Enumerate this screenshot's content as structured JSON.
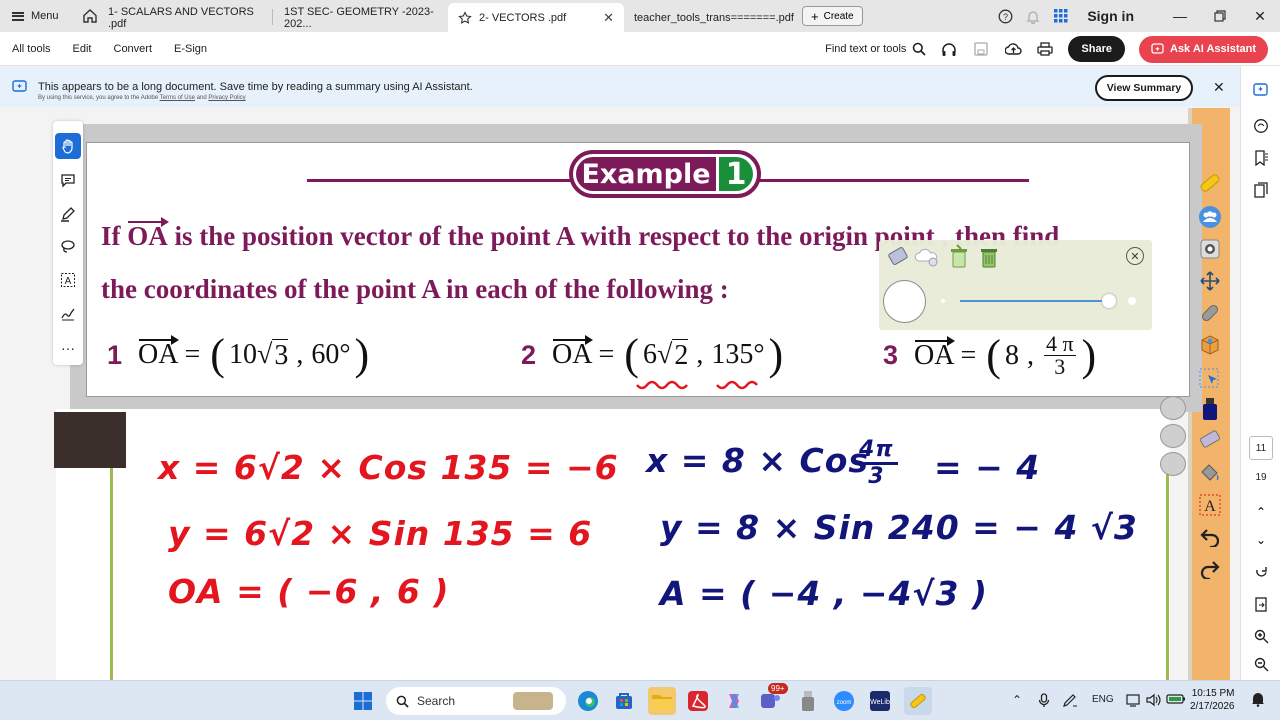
{
  "tabs": {
    "menu_label": "Menu",
    "items": [
      {
        "label": "1- SCALARS AND VECTORS .pdf"
      },
      {
        "label": "1ST SEC- GEOMETRY -2023-202..."
      },
      {
        "label": "2- VECTORS .pdf"
      },
      {
        "label": "teacher_tools_trans=======.pdf"
      }
    ],
    "create_label": "Create",
    "signin_label": "Sign in"
  },
  "toolbar": {
    "items": [
      "All tools",
      "Edit",
      "Convert",
      "E-Sign"
    ],
    "find_label": "Find text or tools",
    "share_label": "Share",
    "ai_label": "Ask AI Assistant"
  },
  "banner": {
    "message": "This appears to be a long document. Save time by reading a summary using AI Assistant.",
    "sub_prefix": "By using this service, you agree to the Adobe",
    "sub_terms": "Terms of Use",
    "sub_and": "and",
    "sub_privacy": "Privacy Policy",
    "view_summary": "View Summary"
  },
  "slide": {
    "example_word": "Example",
    "example_number": "1",
    "line1_pre": "If",
    "line1_vec": "OA",
    "line1_post": "is the position vector of the point A with respect to the origin point , then find",
    "line2": "the coordinates of the point A in each of the following :",
    "items": [
      {
        "num": "1",
        "vec": "OA",
        "eq": "=",
        "a_coef": "10",
        "a_rad": "3",
        "b": "60°"
      },
      {
        "num": "2",
        "vec": "OA",
        "eq": "=",
        "a_coef": "6",
        "a_rad": "2",
        "b": "135°"
      },
      {
        "num": "3",
        "vec": "OA",
        "eq": "=",
        "a": "8",
        "frac_top": "4 π",
        "frac_bot": "3"
      }
    ]
  },
  "handwriting": {
    "red": [
      "x = 6√2 × Cos 135 = −6",
      "y = 6√2 × Sin 135 = 6",
      "OA = ( −6 , 6 )"
    ],
    "blue": [
      "x = 8 × Cos",
      "= − 4",
      "y = 8 × Sin 240 = − 4 √3",
      "A = ( −4 , −4√3 )"
    ],
    "blue_frac_top": "4π",
    "blue_frac_bot": "3"
  },
  "right_rail": {
    "page_current": "11",
    "page_total": "19"
  },
  "taskbar": {
    "search_label": "Search",
    "badge": "99+",
    "lang": "ENG",
    "time": "10:15 PM",
    "date": "2/17/2026"
  },
  "colors": {
    "plum": "#7d1a5a",
    "green": "#1a8e3b",
    "ink_red": "#e3161f",
    "ink_blue": "#12157a",
    "share": "#1b1b1b",
    "ai": "#e8434e"
  }
}
